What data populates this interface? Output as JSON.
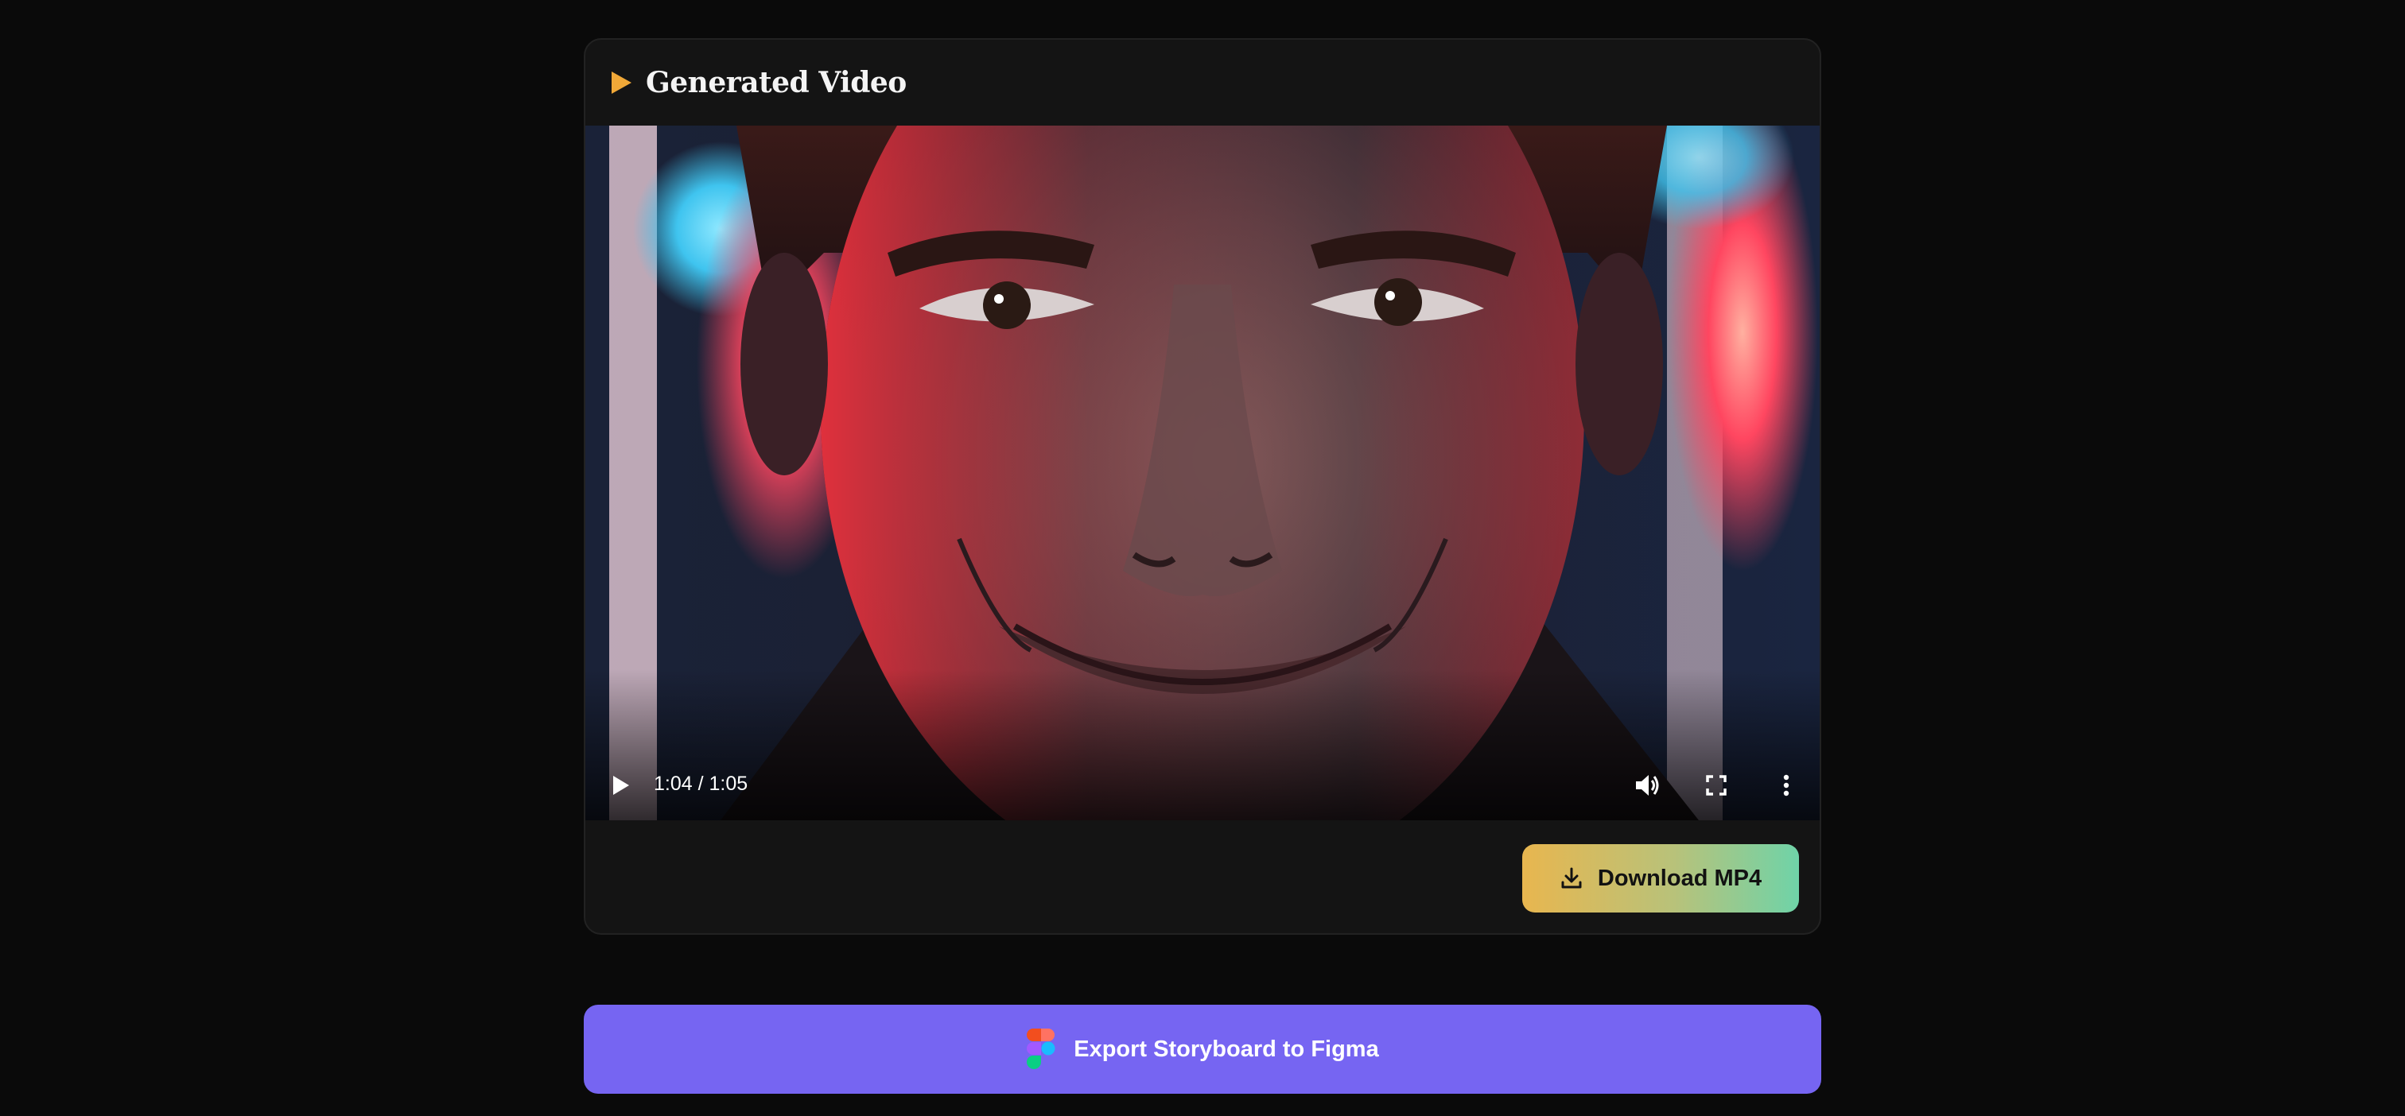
{
  "card": {
    "title": "Generated Video",
    "title_icon": "play-triangle-icon",
    "accent": "#f0a838"
  },
  "player": {
    "time_display": "1:04 / 1:05",
    "progress_fraction": 0.985,
    "icons": [
      "play-icon",
      "volume-icon",
      "fullscreen-icon",
      "more-options-icon"
    ]
  },
  "download": {
    "label": "Download MP4",
    "icon": "download-icon"
  },
  "export": {
    "label": "Export Storyboard to Figma",
    "icon": "figma-logo-icon",
    "color": "#7665f2"
  }
}
